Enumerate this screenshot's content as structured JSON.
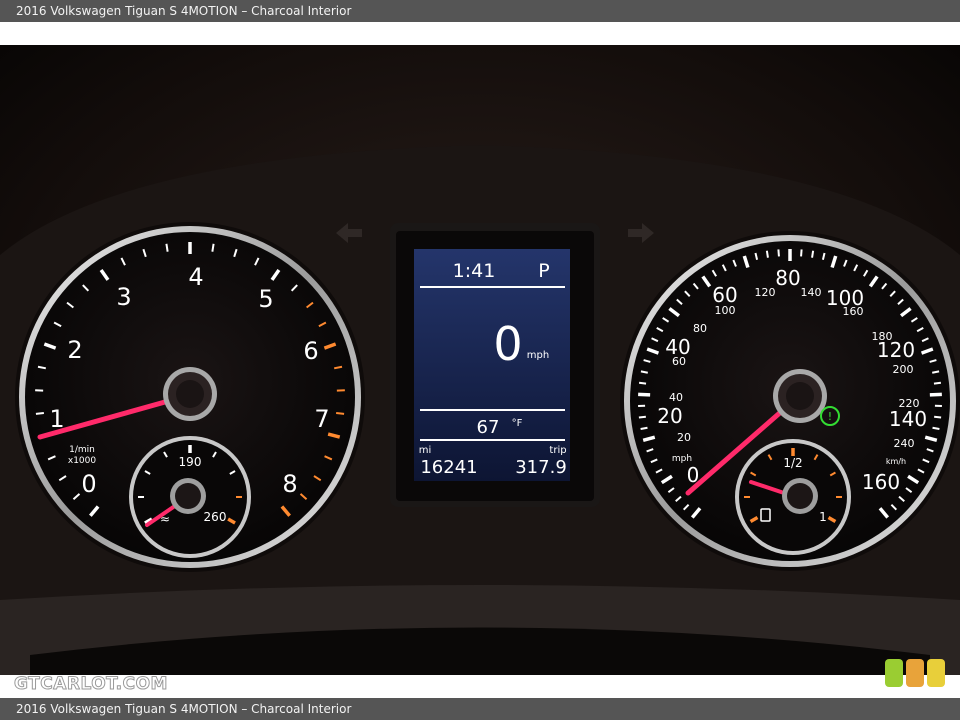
{
  "caption": {
    "top": "2016 Volkswagen Tiguan S 4MOTION – Charcoal Interior",
    "bottom": "2016 Volkswagen Tiguan S 4MOTION – Charcoal Interior"
  },
  "watermark": "GTCARLOT.COM",
  "tachometer": {
    "labels": [
      "0",
      "1",
      "2",
      "3",
      "4",
      "5",
      "6",
      "7",
      "8"
    ],
    "unit_top": "1/min",
    "unit_bottom": "x1000",
    "needle_rpm": 1.0
  },
  "coolant_gauge": {
    "low": "190",
    "high": "260"
  },
  "display": {
    "time": "1:41",
    "gear": "P",
    "speed": "0",
    "speed_unit": "mph",
    "temperature": "67",
    "temp_unit": "°F",
    "odometer_label": "mi",
    "trip_label": "trip",
    "odometer": "16241",
    "trip": "317.9"
  },
  "speedometer": {
    "mph_labels": [
      "0",
      "20",
      "40",
      "60",
      "80",
      "100",
      "120",
      "140",
      "160"
    ],
    "kmh_labels": [
      "20",
      "40",
      "60",
      "80",
      "100",
      "120",
      "140",
      "160",
      "180",
      "200",
      "220",
      "240"
    ],
    "mph_unit": "mph",
    "kmh_unit": "km/h",
    "speed_mph": 0
  },
  "fuel_gauge": {
    "half": "1/2",
    "full": "1"
  },
  "colors": {
    "needle": "#ff2a6a",
    "ring": "#d8d8d8",
    "redline": "#ff8a30",
    "display_bg": "#1a2a5a",
    "indicator_green": "#33dd33",
    "swatch_green": "#9acd32",
    "swatch_orange": "#e8a33a",
    "swatch_yellow": "#e8cf3a"
  }
}
